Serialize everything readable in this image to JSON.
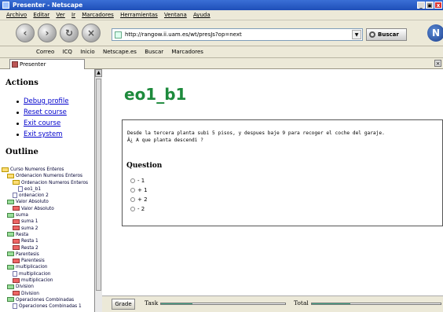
{
  "window": {
    "title": "Presenter - Netscape",
    "controls": [
      "_",
      "▣",
      "x"
    ]
  },
  "menu": [
    "Archivo",
    "Editar",
    "Ver",
    "Ir",
    "Marcadores",
    "Herramientas",
    "Ventana",
    "Ayuda"
  ],
  "nav": {
    "url": "http://rangow.ii.uam.es/wt/presJs?op=next",
    "search_label": "Buscar"
  },
  "bookmarks": [
    "Correo",
    "ICQ",
    "Inicio",
    "Netscape.es",
    "Buscar",
    "Marcadores"
  ],
  "tab": {
    "label": "Presenter"
  },
  "left": {
    "actions_heading": "Actions",
    "actions": [
      "Debug profile",
      "Reset course",
      "Exit course",
      "Exit system"
    ],
    "outline_heading": "Outline",
    "tree": [
      {
        "label": "Curso Numeros Enteros",
        "depth": 0,
        "icon": "folder-open"
      },
      {
        "label": "Ordenacion Numeros Enteros",
        "depth": 1,
        "icon": "folder-open"
      },
      {
        "label": "Ordenacion Numeros Enteros",
        "depth": 2,
        "icon": "folder-open"
      },
      {
        "label": "eo1_b1",
        "depth": 3,
        "icon": "doc"
      },
      {
        "label": "ordenacion 2",
        "depth": 2,
        "icon": "doc"
      },
      {
        "label": "Valor Absoluto",
        "depth": 1,
        "icon": "folder-green"
      },
      {
        "label": "Valor Absoluto",
        "depth": 2,
        "icon": "folder-red"
      },
      {
        "label": "suma",
        "depth": 1,
        "icon": "folder-green"
      },
      {
        "label": "suma 1",
        "depth": 2,
        "icon": "folder-red"
      },
      {
        "label": "suma 2",
        "depth": 2,
        "icon": "folder-red"
      },
      {
        "label": "Resta",
        "depth": 1,
        "icon": "folder-green"
      },
      {
        "label": "Resta 1",
        "depth": 2,
        "icon": "folder-red"
      },
      {
        "label": "Resta 2",
        "depth": 2,
        "icon": "folder-red"
      },
      {
        "label": "Parentesis",
        "depth": 1,
        "icon": "folder-green"
      },
      {
        "label": "Parentesis",
        "depth": 2,
        "icon": "folder-red"
      },
      {
        "label": "multiplicacion",
        "depth": 1,
        "icon": "folder-green"
      },
      {
        "label": "multiplicacion",
        "depth": 2,
        "icon": "doc"
      },
      {
        "label": "multiplicacion",
        "depth": 2,
        "icon": "folder-red"
      },
      {
        "label": "Division",
        "depth": 1,
        "icon": "folder-green"
      },
      {
        "label": "Division",
        "depth": 2,
        "icon": "folder-red"
      },
      {
        "label": "Operaciones Combinadas",
        "depth": 1,
        "icon": "folder-green"
      },
      {
        "label": "Operaciones Combinadas 1",
        "depth": 2,
        "icon": "doc"
      }
    ]
  },
  "main": {
    "title": "eo1_b1",
    "question_line1": "Desde la tercera planta subi 5 pisos, y despues baje 9 para recoger el coche del garaje.",
    "question_line2": "Â¿ A que planta descendi ?",
    "question_heading": "Question",
    "options": [
      "- 1",
      "+ 1",
      "+ 2",
      "- 2"
    ]
  },
  "bottom": {
    "grade_label": "Grade",
    "task_label": "Task",
    "total_label": "Total",
    "task_progress": 0.25,
    "total_progress": 0.3
  }
}
